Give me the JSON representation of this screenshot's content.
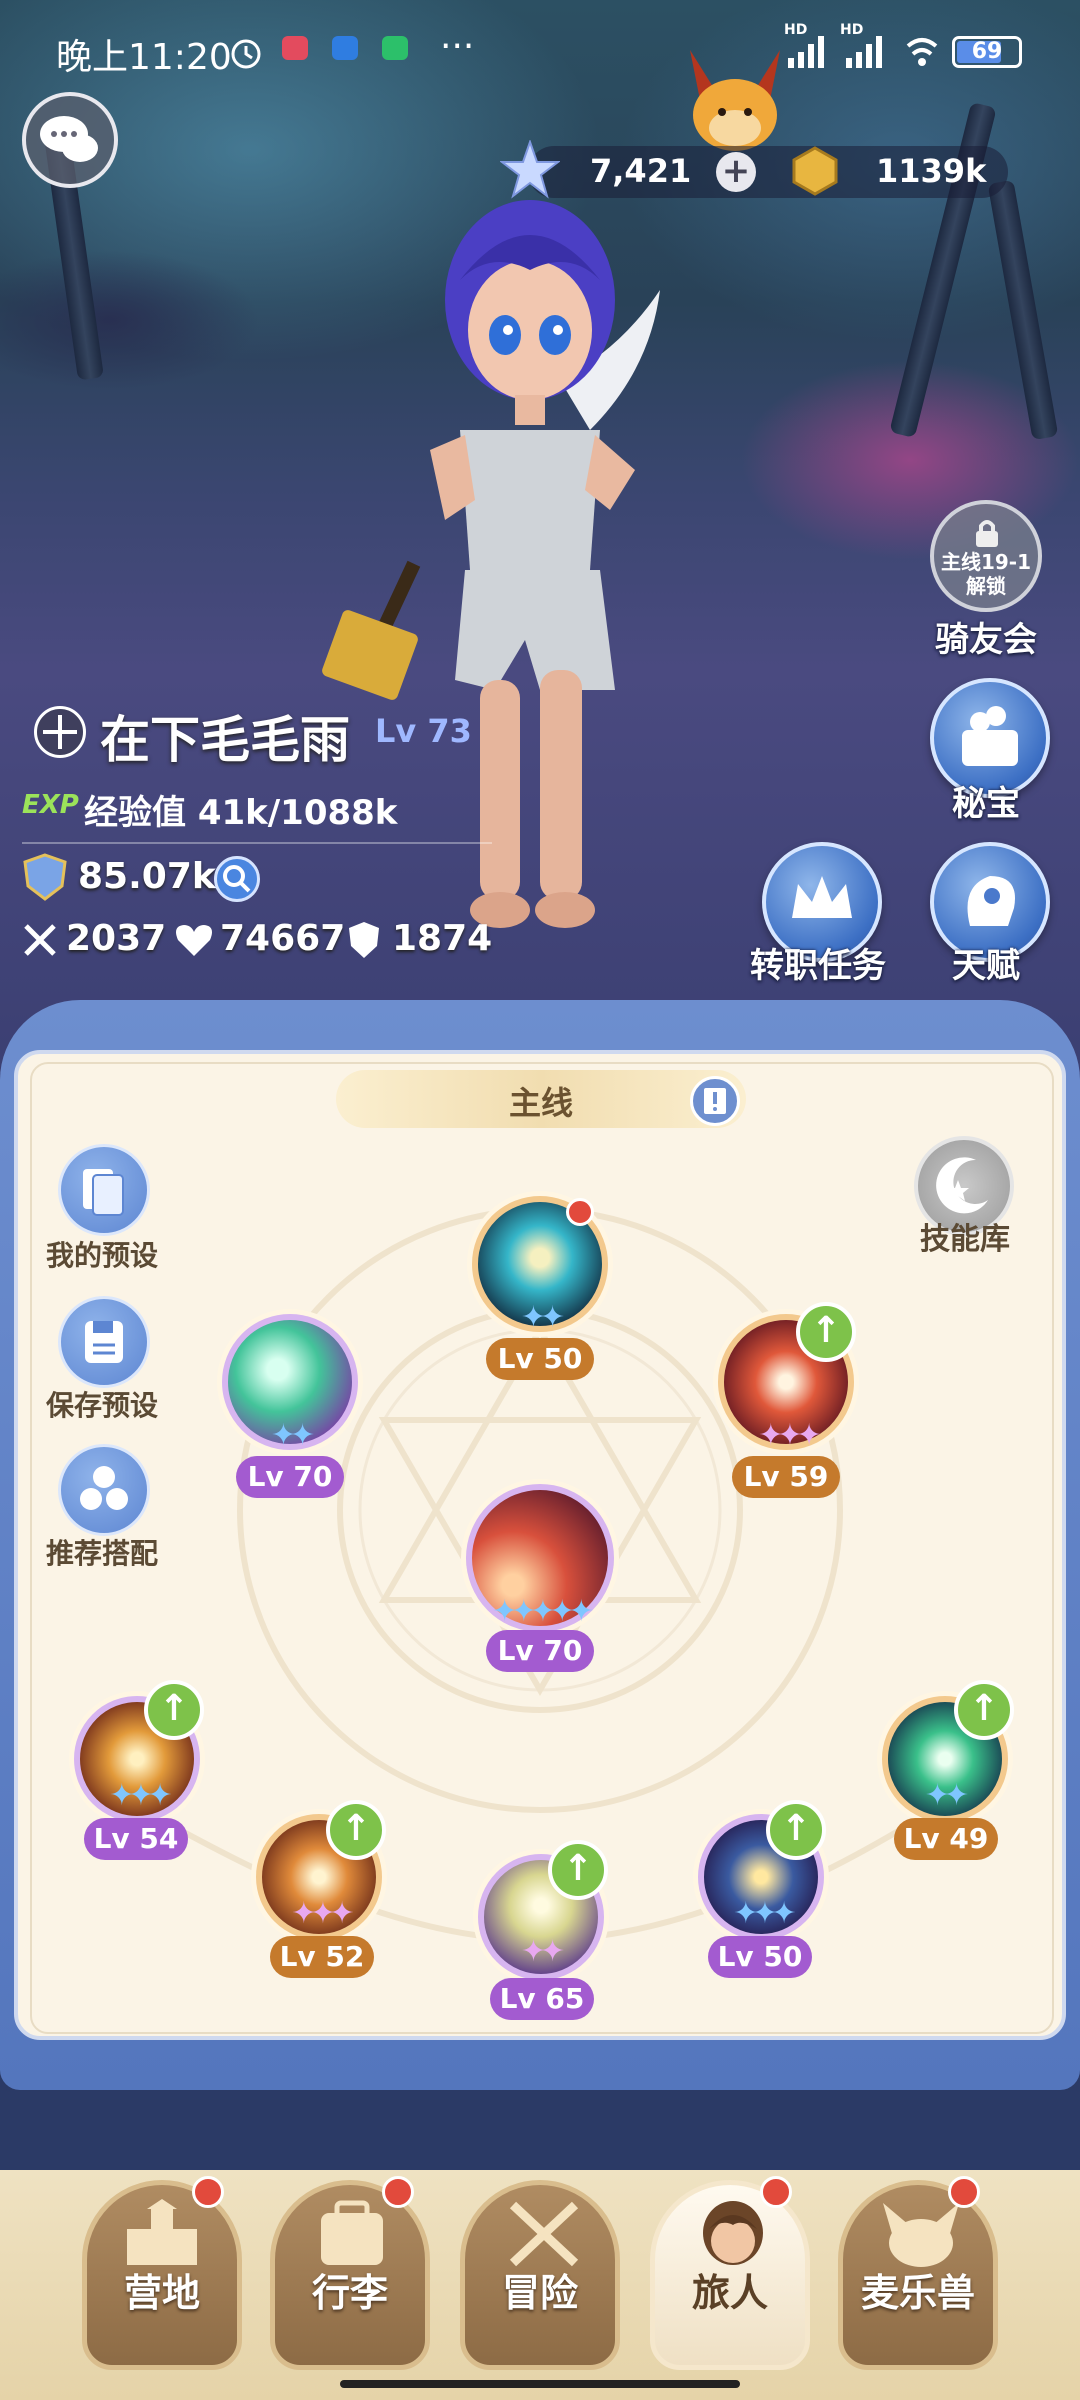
{
  "status_bar": {
    "time": "晚上11:20",
    "dots": "···",
    "hd1": "HD",
    "hd2": "HD",
    "battery": "69"
  },
  "currency": {
    "gems": "7,421",
    "gold": "1139k",
    "add_symbol": "+"
  },
  "side_buttons": {
    "rider_lock": "主线19-1\n解锁",
    "rider_label": "骑友会",
    "treasure_label": "秘宝",
    "job_quest_label": "转职任务",
    "talent_label": "天赋"
  },
  "character": {
    "name": "在下毛毛雨",
    "level": "Lv 73",
    "exp_tag": "EXP",
    "exp_text": "经验值 41k/1088k",
    "power": "85.07k",
    "attack": "2037",
    "hp": "74667",
    "defense": "1874"
  },
  "panel": {
    "tab_label": "主线",
    "skill_library": "技能库",
    "my_preset": "我的预设",
    "save_preset": "保存预设",
    "recommend": "推荐搭配"
  },
  "skills": [
    {
      "id": "top",
      "level": "Lv 50",
      "stars": "✦✦",
      "badge_color": "#c57a2c"
    },
    {
      "id": "upper-left",
      "level": "Lv 70",
      "stars": "✦✦",
      "badge_color": "#a35bd0"
    },
    {
      "id": "upper-right",
      "level": "Lv 59",
      "stars": "✦✦✦",
      "badge_color": "#c57a2c"
    },
    {
      "id": "center",
      "level": "Lv 70",
      "stars": "✦✦✦✦✦",
      "badge_color": "#a35bd0"
    },
    {
      "id": "left",
      "level": "Lv 54",
      "stars": "✦✦✦",
      "badge_color": "#a35bd0"
    },
    {
      "id": "lower-left",
      "level": "Lv 52",
      "stars": "✦✦✦",
      "badge_color": "#c57a2c"
    },
    {
      "id": "bottom",
      "level": "Lv 65",
      "stars": "✦✦",
      "badge_color": "#a35bd0"
    },
    {
      "id": "lower-right",
      "level": "Lv 50",
      "stars": "✦✦✦",
      "badge_color": "#a35bd0"
    },
    {
      "id": "right",
      "level": "Lv 49",
      "stars": "✦✦",
      "badge_color": "#c57a2c"
    }
  ],
  "nav": [
    {
      "label": "营地"
    },
    {
      "label": "行李"
    },
    {
      "label": "冒险"
    },
    {
      "label": "旅人"
    },
    {
      "label": "麦乐兽"
    }
  ]
}
